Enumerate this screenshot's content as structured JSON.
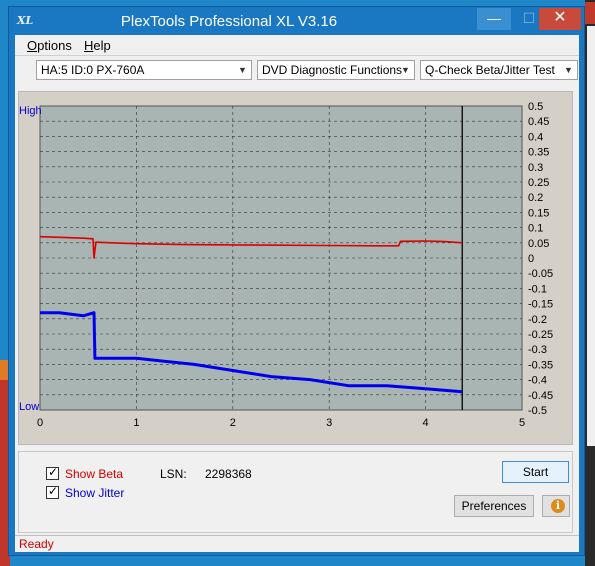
{
  "window": {
    "title": "PlexTools Professional XL V3.16",
    "icon_text": "XL",
    "min_symbol": "—",
    "max_symbol": "☐",
    "close_symbol": "✕"
  },
  "menu": {
    "options_label": "Options",
    "options_hotkey": "O",
    "help_label": "Help",
    "help_hotkey": "H"
  },
  "toolbar": {
    "drive_select": "HA:5 ID:0  PX-760A",
    "function_select": "DVD Diagnostic Functions",
    "test_select": "Q-Check Beta/Jitter Test"
  },
  "chart_data": {
    "type": "line",
    "x_ticks": [
      "0",
      "1",
      "2",
      "3",
      "4",
      "5"
    ],
    "xlim": [
      0,
      5
    ],
    "y_right_ticks": [
      "0.5",
      "0.45",
      "0.4",
      "0.35",
      "0.3",
      "0.25",
      "0.2",
      "0.15",
      "0.1",
      "0.05",
      "0",
      "-0.05",
      "-0.1",
      "-0.15",
      "-0.2",
      "-0.25",
      "-0.3",
      "-0.35",
      "-0.4",
      "-0.45",
      "-0.5"
    ],
    "ylim": [
      -0.5,
      0.5
    ],
    "y_left_top": "High",
    "y_left_bottom": "Low",
    "end_marker_x": 4.38,
    "grid": true,
    "series": [
      {
        "name": "Beta",
        "color": "#dd0000",
        "points": [
          [
            0,
            0.07
          ],
          [
            0.2,
            0.068
          ],
          [
            0.45,
            0.065
          ],
          [
            0.55,
            0.063
          ],
          [
            0.56,
            0.0
          ],
          [
            0.58,
            0.052
          ],
          [
            1,
            0.047
          ],
          [
            1.5,
            0.044
          ],
          [
            2,
            0.043
          ],
          [
            2.5,
            0.042
          ],
          [
            3,
            0.041
          ],
          [
            3.5,
            0.04
          ],
          [
            3.72,
            0.04
          ],
          [
            3.74,
            0.055
          ],
          [
            4,
            0.056
          ],
          [
            4.2,
            0.054
          ],
          [
            4.38,
            0.05
          ]
        ]
      },
      {
        "name": "Jitter",
        "color": "#0000ee",
        "points": [
          [
            0,
            -0.18
          ],
          [
            0.2,
            -0.18
          ],
          [
            0.45,
            -0.19
          ],
          [
            0.56,
            -0.18
          ],
          [
            0.57,
            -0.33
          ],
          [
            0.8,
            -0.33
          ],
          [
            1,
            -0.33
          ],
          [
            1.3,
            -0.34
          ],
          [
            1.6,
            -0.35
          ],
          [
            2,
            -0.37
          ],
          [
            2.4,
            -0.39
          ],
          [
            2.8,
            -0.4
          ],
          [
            3.2,
            -0.42
          ],
          [
            3.6,
            -0.42
          ],
          [
            4,
            -0.43
          ],
          [
            4.38,
            -0.44
          ]
        ]
      }
    ]
  },
  "options": {
    "show_beta": "Show Beta",
    "show_jitter": "Show Jitter",
    "show_beta_checked": true,
    "show_jitter_checked": true
  },
  "lsn": {
    "label": "LSN:",
    "value": "2298368"
  },
  "buttons": {
    "start": "Start",
    "preferences": "Preferences",
    "info": "i"
  },
  "status": {
    "text": "Ready"
  },
  "colors": {
    "accent": "#1a78c2",
    "beta": "#dd0000",
    "jitter": "#0000ee",
    "plot_bg": "#a9b5b2"
  }
}
